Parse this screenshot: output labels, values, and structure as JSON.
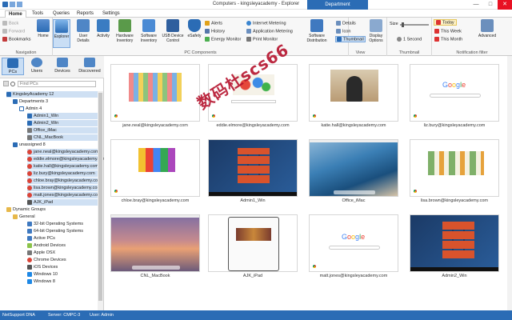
{
  "app": {
    "title": "Computers - kingsleyacademy - Explorer",
    "context_tab_group": "Department",
    "context_tab_sub": "kingsleyacademy",
    "win_min": "—",
    "win_max": "□",
    "win_close": "✕"
  },
  "tabs": [
    "Home",
    "Tools",
    "Queries",
    "Reports",
    "Settings"
  ],
  "ribbon": {
    "back": "Back",
    "forward": "Forward",
    "bookmarks": "Bookmarks",
    "home": "Home",
    "explorer": "Explorer",
    "user_details": "User Details",
    "activity": "Activity",
    "hardware_inventory": "Hardware Inventory",
    "software_inventory": "Software Inventory",
    "usb_device_control": "USB Device Control",
    "esafety": "eSafety",
    "alerts": "Alerts",
    "history": "History",
    "energy_monitor": "Energy Monitor",
    "internet_metering": "Internet Metering",
    "application_metering": "Application Metering",
    "print_monitor": "Print Monitor",
    "software_distribution": "Software Distribution",
    "view_details": "Details",
    "view_icon": "Icon",
    "view_thumbnail": "Thumbnail",
    "display_options": "Display Options",
    "size_label": "Size",
    "interval": "1 Second",
    "filter_today": "Today",
    "filter_this_week": "This Week",
    "filter_this_month": "This Month",
    "advanced": "Advanced",
    "groups": {
      "navigation": "Navigation",
      "pc_components": "PC Components",
      "view": "View",
      "thumbnail": "Thumbnail",
      "notification_filter": "Notification filter"
    }
  },
  "nav": {
    "pcs": "PCs",
    "users": "Users",
    "devices": "Devices",
    "discovered": "Discovered"
  },
  "find": {
    "placeholder": "Find PCs"
  },
  "tree": [
    "KingsleyAcademy 12",
    "Departments 3",
    "Admin 4",
    "Admin1_Win",
    "Admin2_Win",
    "Office_iMac",
    "CNL_MacBook",
    "unassigned 8",
    "jane.neal@kingsleyacademy.com",
    "eddie.elmore@kingsleyacademy.com",
    "katie.hall@kingsleyacademy.com",
    "liz.bury@kingsleyacademy.com",
    "chloe.bray@kingsleyacademy.com",
    "lisa.brown@kingsleyacademy.com",
    "matt.jones@kingsleyacademy.com",
    "AJK_iPad",
    "Dynamic Groups",
    "General",
    "32-bit Operating Systems",
    "64-bit Operating Systems",
    "Active PCs",
    "Android Devices",
    "Apple OSX",
    "Chrome Devices",
    "iOS Devices",
    "Windows 10",
    "Windows 8"
  ],
  "thumbnails": [
    {
      "label": "jane.neal@kingsleyacademy.com",
      "kind": "doodle"
    },
    {
      "label": "eddie.elmore@kingsleyacademy.com",
      "kind": "doodle2"
    },
    {
      "label": "katie.hall@kingsleyacademy.com",
      "kind": "doodle3"
    },
    {
      "label": "liz.bury@kingsleyacademy.com",
      "kind": "google"
    },
    {
      "label": "chloe.bray@kingsleyacademy.com",
      "kind": "doodle4"
    },
    {
      "label": "Admin1_Win",
      "kind": "win10"
    },
    {
      "label": "Office_iMac",
      "kind": "mac"
    },
    {
      "label": "lisa.brown@kingsleyacademy.com",
      "kind": "doodle5"
    },
    {
      "label": "CNL_MacBook",
      "kind": "sierra"
    },
    {
      "label": "AJK_iPad",
      "kind": "ipad"
    },
    {
      "label": "matt.jones@kingsleyacademy.com",
      "kind": "google"
    },
    {
      "label": "Admin2_Win",
      "kind": "win10b"
    }
  ],
  "watermark": "数码杜scs66",
  "status": {
    "brand": "NetSupport DNA",
    "server": "Server: CMPC-3",
    "user": "User: Admin"
  },
  "colors": {
    "accent": "#2b6cb5",
    "selection": "#c9def5",
    "close": "#e81123"
  }
}
